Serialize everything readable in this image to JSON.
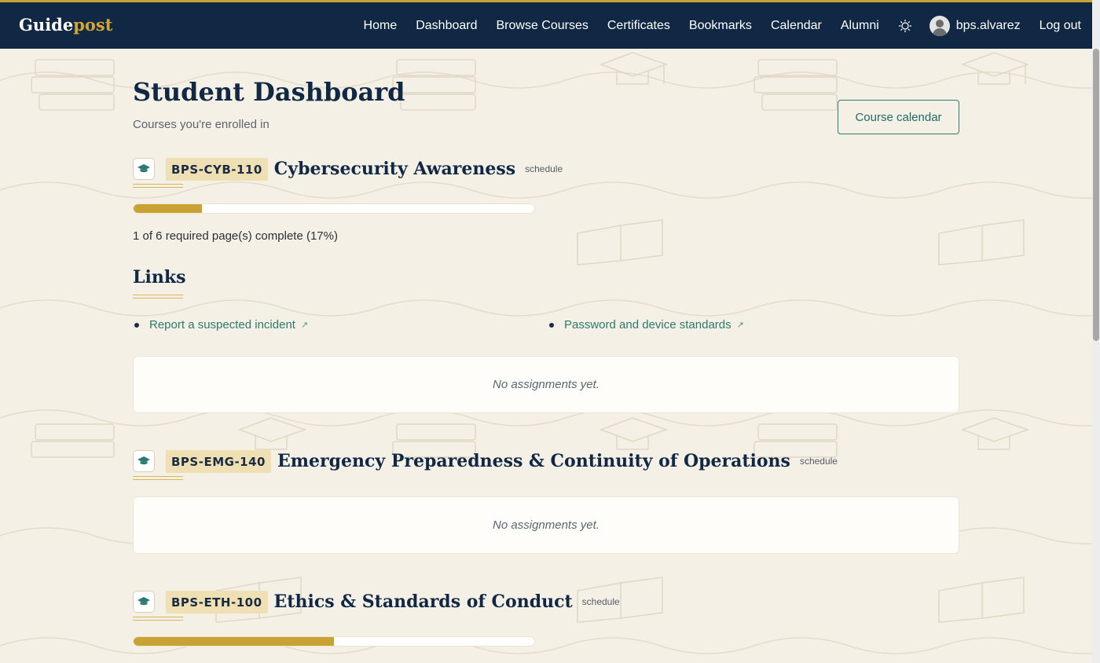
{
  "header": {
    "brand_primary": "Guide",
    "brand_accent": "post",
    "nav": [
      "Home",
      "Dashboard",
      "Browse Courses",
      "Certificates",
      "Bookmarks",
      "Calendar",
      "Alumni"
    ],
    "theme_icon": "sun-icon",
    "username": "bps.alvarez",
    "logout": "Log out"
  },
  "page": {
    "title": "Student Dashboard",
    "subtitle": "Courses you're enrolled in",
    "calendar_button": "Course calendar"
  },
  "courses": [
    {
      "code": "BPS-CYB-110",
      "title": "Cybersecurity Awareness",
      "schedule": "schedule",
      "progress": 0.17,
      "progress_text": "1 of 6 required page(s) complete (17%)",
      "links_heading": "Links",
      "links": [
        "Report a suspected incident",
        "Password and device standards"
      ],
      "assignments_empty": "No assignments yet."
    },
    {
      "code": "BPS-EMG-140",
      "title": "Emergency Preparedness & Continuity of Operations",
      "schedule": "schedule",
      "assignments_empty": "No assignments yet."
    },
    {
      "code": "BPS-ETH-100",
      "title": "Ethics & Standards of Conduct",
      "schedule": "schedule",
      "progress": 0.5
    }
  ],
  "colors": {
    "navbar": "#112845",
    "accent_gold": "#c9a233",
    "link_teal": "#2b7a6f",
    "background": "#f5f0e6"
  }
}
